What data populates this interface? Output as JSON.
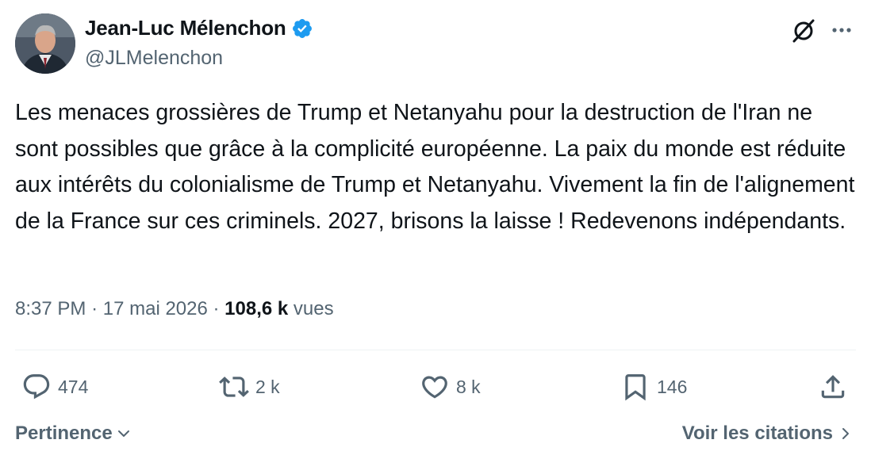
{
  "author": {
    "name": "Jean-Luc Mélenchon",
    "handle": "@JLMelenchon",
    "verified": true
  },
  "tweet": {
    "text": "Les menaces grossières de Trump et Netanyahu pour la destruction de l'Iran ne sont possibles que grâce à la complicité européenne. La paix du monde est réduite aux intérêts du colonialisme de Trump et Netanyahu. Vivement la fin de l'alignement de la France sur ces criminels. 2027, brisons la laisse ! Redevenons indépendants."
  },
  "meta": {
    "time": "8:37 PM",
    "date": "17 mai 2026",
    "separator": "·",
    "views_count": "108,6 k",
    "views_label": "vues"
  },
  "actions": {
    "replies": "474",
    "retweets": "2 k",
    "likes": "8 k",
    "bookmarks": "146"
  },
  "footer": {
    "sort_label": "Pertinence",
    "quotes_label": "Voir les citations"
  },
  "colors": {
    "text_primary": "#0f1419",
    "text_secondary": "#536471",
    "verified": "#1d9bf0",
    "divider": "#eff3f4"
  },
  "icons": {
    "verified": "verified-badge-icon",
    "grok": "grok-icon",
    "more": "more-icon",
    "reply": "reply-icon",
    "retweet": "retweet-icon",
    "like": "heart-icon",
    "bookmark": "bookmark-icon",
    "share": "share-icon"
  }
}
